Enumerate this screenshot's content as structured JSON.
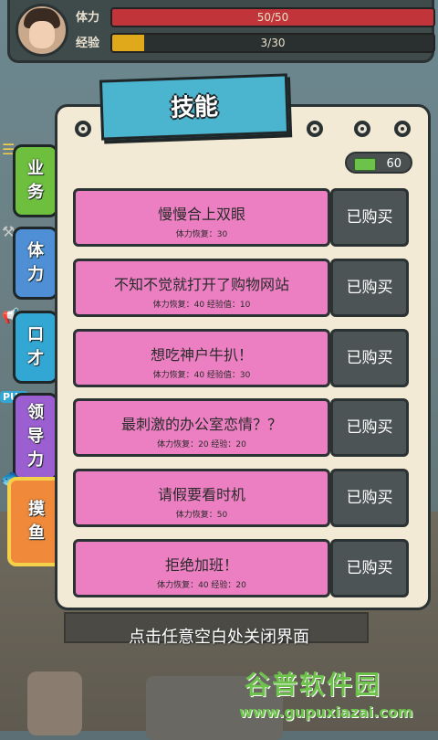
{
  "status": {
    "stamina_label": "体力",
    "stamina_value": "50/50",
    "stamina_fraction": 1.0,
    "exp_label": "经验",
    "exp_value": "3/30",
    "exp_fraction": 0.1
  },
  "tabs": [
    {
      "label": [
        "业",
        "务"
      ]
    },
    {
      "label": [
        "体",
        "力"
      ]
    },
    {
      "label": [
        "口",
        "才"
      ]
    },
    {
      "label": [
        "领",
        "导",
        "力"
      ]
    },
    {
      "label": [
        "摸",
        "鱼"
      ]
    }
  ],
  "tab_badge": "PUA",
  "panel": {
    "title": "技能",
    "money": "60"
  },
  "skills": [
    {
      "name": "慢慢合上双眼",
      "effect": "体力恢复：30",
      "button": "已购买"
    },
    {
      "name": "不知不觉就打开了购物网站",
      "effect": "体力恢复：40    经验值：10",
      "button": "已购买"
    },
    {
      "name": "想吃神户牛扒！",
      "effect": "体力恢复：40    经验值：30",
      "button": "已购买"
    },
    {
      "name": "最刺激的办公室恋情？？",
      "effect": "体力恢复：20    经验：20",
      "button": "已购买"
    },
    {
      "name": "请假要看时机",
      "effect": "体力恢复：50",
      "button": "已购买"
    },
    {
      "name": "拒绝加班！",
      "effect": "体力恢复：40    经验：20",
      "button": "已购买"
    }
  ],
  "hint": "点击任意空白处关闭界面",
  "watermark": {
    "title": "谷普软件园",
    "url": "www.gupuxiazai.com"
  },
  "colors": {
    "stamina_bar": "#c0343a",
    "exp_bar": "#e0a91c",
    "skill_card": "#ec7fc2",
    "bought_button": "#4d5455"
  }
}
